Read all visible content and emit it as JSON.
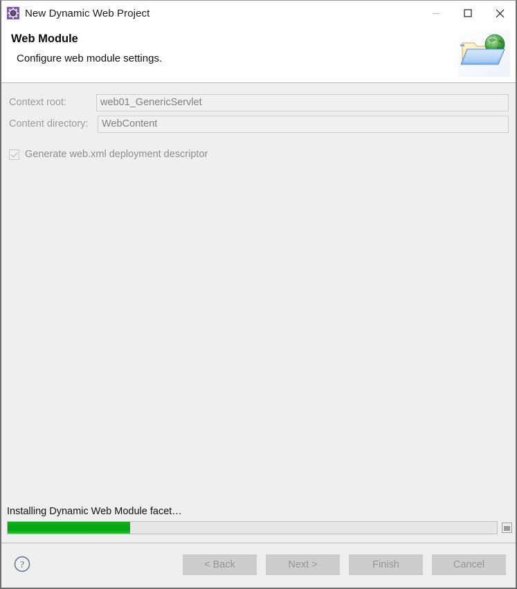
{
  "window": {
    "title": "New Dynamic Web Project",
    "app_icon": "project-wizard-icon",
    "controls": {
      "minimize": "minimize-icon",
      "maximize": "maximize-icon",
      "close": "close-icon"
    }
  },
  "header": {
    "title": "Web Module",
    "subtitle": "Configure web module settings.",
    "graphic": "web-folder-globe-icon"
  },
  "form": {
    "context_root": {
      "label": "Context root:",
      "value": "web01_GenericServlet"
    },
    "content_directory": {
      "label": "Content directory:",
      "value": "WebContent"
    },
    "generate_webxml": {
      "label": "Generate web.xml deployment descriptor",
      "checked": "true"
    }
  },
  "progress": {
    "status": "Installing Dynamic Web Module facet…",
    "percent": 25,
    "fill_color": "#06a513",
    "cancel_icon": "stop-progress-icon"
  },
  "footer": {
    "help_icon": "help-question-icon",
    "buttons": [
      {
        "label": "< Back",
        "name": "back-button"
      },
      {
        "label": "Next >",
        "name": "next-button"
      },
      {
        "label": "Finish",
        "name": "finish-button"
      },
      {
        "label": "Cancel",
        "name": "cancel-button"
      }
    ]
  }
}
